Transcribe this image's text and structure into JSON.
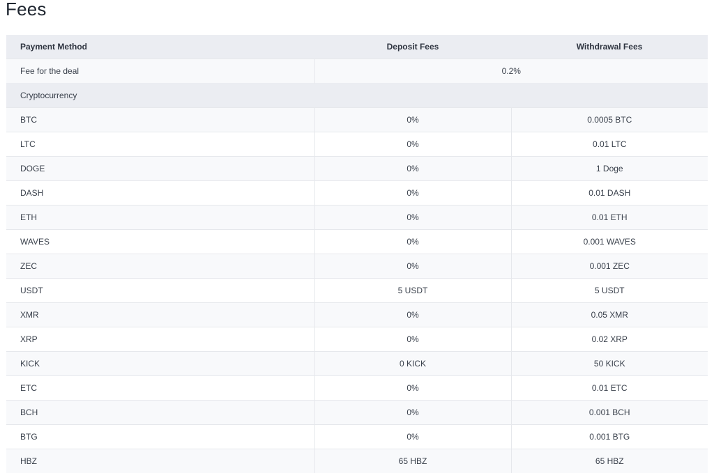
{
  "page": {
    "title": "Fees"
  },
  "table": {
    "headers": [
      "Payment Method",
      "Deposit Fees",
      "Withdrawal Fees"
    ],
    "deal_row": {
      "label": "Fee for the deal",
      "value": "0.2%"
    },
    "section_label": "Cryptocurrency",
    "rows": [
      {
        "method": "BTC",
        "deposit": "0%",
        "withdrawal": "0.0005 BTC"
      },
      {
        "method": "LTC",
        "deposit": "0%",
        "withdrawal": "0.01 LTC"
      },
      {
        "method": "DOGE",
        "deposit": "0%",
        "withdrawal": "1 Doge"
      },
      {
        "method": "DASH",
        "deposit": "0%",
        "withdrawal": "0.01 DASH"
      },
      {
        "method": "ETH",
        "deposit": "0%",
        "withdrawal": "0.01 ETH"
      },
      {
        "method": "WAVES",
        "deposit": "0%",
        "withdrawal": "0.001 WAVES"
      },
      {
        "method": "ZEC",
        "deposit": "0%",
        "withdrawal": "0.001 ZEC"
      },
      {
        "method": "USDT",
        "deposit": "5 USDT",
        "withdrawal": "5 USDT"
      },
      {
        "method": "XMR",
        "deposit": "0%",
        "withdrawal": "0.05 XMR"
      },
      {
        "method": "XRP",
        "deposit": "0%",
        "withdrawal": "0.02 XRP"
      },
      {
        "method": "KICK",
        "deposit": "0 KICK",
        "withdrawal": "50 KICK"
      },
      {
        "method": "ETC",
        "deposit": "0%",
        "withdrawal": "0.01 ETC"
      },
      {
        "method": "BCH",
        "deposit": "0%",
        "withdrawal": "0.001 BCH"
      },
      {
        "method": "BTG",
        "deposit": "0%",
        "withdrawal": "0.001 BTG"
      },
      {
        "method": "HBZ",
        "deposit": "65 HBZ",
        "withdrawal": "65 HBZ"
      }
    ]
  }
}
